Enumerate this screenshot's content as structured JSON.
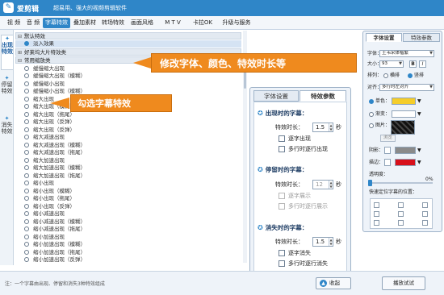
{
  "app": {
    "name": "爱剪辑",
    "tagline": "超易用、强大的视频剪辑软件"
  },
  "menu": [
    "视 频",
    "音 频",
    "字幕特效",
    "叠加素材",
    "转场特效",
    "画面风格",
    "M T V",
    "卡拉OK",
    "升级与服务"
  ],
  "active_menu_index": 2,
  "left_tabs": [
    {
      "label": "出现特效",
      "active": true
    },
    {
      "label": "停留特效",
      "active": false
    },
    {
      "label": "消失特效",
      "active": false
    }
  ],
  "tree": {
    "groups": [
      {
        "label": "默认特效",
        "items": [
          {
            "label": "淡入效果",
            "selected": true
          }
        ]
      },
      {
        "label": "好莱坞大片特效类",
        "items": []
      },
      {
        "label": "常用缩放类",
        "items": [
          {
            "label": "缓慢缩大出现"
          },
          {
            "label": "缓慢缩大出现（模糊）"
          },
          {
            "label": "缓慢缩小出现"
          },
          {
            "label": "缓慢缩小出现（模糊）"
          },
          {
            "label": "缩大出现"
          },
          {
            "label": "缩大出现（模糊）"
          },
          {
            "label": "缩大出现（拖尾）"
          },
          {
            "label": "缩大出现（反弹）"
          },
          {
            "label": "缩大出现（反弹）"
          },
          {
            "label": "缩大减速出现"
          },
          {
            "label": "缩大减速出现（模糊）"
          },
          {
            "label": "缩大减速出现（拖尾）"
          },
          {
            "label": "缩大加速出现"
          },
          {
            "label": "缩大加速出现（模糊）"
          },
          {
            "label": "缩大加速出现（拖尾）"
          },
          {
            "label": "缩小出现"
          },
          {
            "label": "缩小出现（模糊）"
          },
          {
            "label": "缩小出现（拖尾）"
          },
          {
            "label": "缩小出现（反弹）"
          },
          {
            "label": "缩小减速出现"
          },
          {
            "label": "缩小减速出现（模糊）"
          },
          {
            "label": "缩小减速出现（拖尾）"
          },
          {
            "label": "缩小加速出现"
          },
          {
            "label": "缩小加速出现（模糊）"
          },
          {
            "label": "缩小加速出现（拖尾）"
          },
          {
            "label": "缩小加速出现（反弹）"
          }
        ]
      }
    ]
  },
  "callouts": {
    "select_effect": "勾选字幕特效",
    "modify_font": "修改字体、颜色、特效时长等"
  },
  "effect_panel": {
    "tabs": [
      "字体设置",
      "特效参数"
    ],
    "active_tab": 1,
    "duration_label": "特效时长：",
    "unit": "秒",
    "sections": [
      {
        "title": "出现时的字幕：",
        "duration": "1.5",
        "disabled": false,
        "options": [
          {
            "label": "逐字出现",
            "disabled": false
          },
          {
            "label": "多行时逐行出现",
            "disabled": false
          }
        ]
      },
      {
        "title": "停留时的字幕：",
        "duration": "12",
        "disabled": true,
        "options": [
          {
            "label": "逐字展示",
            "disabled": true
          },
          {
            "label": "多行时逐行展示",
            "disabled": true
          }
        ]
      },
      {
        "title": "消失时的字幕：",
        "duration": "1.5",
        "disabled": false,
        "options": [
          {
            "label": "逐字消失",
            "disabled": false
          },
          {
            "label": "多行时逐行消失",
            "disabled": false
          }
        ]
      }
    ]
  },
  "font_panel": {
    "tabs": [
      "字体设置",
      "特效参数"
    ],
    "active_tab": 0,
    "font_label": "字体：",
    "font_value": "王韦宋体楷繁",
    "size_label": "大小：",
    "size_value": "93",
    "bold": "B",
    "italic": "I",
    "layout_label": "排列：",
    "layout_options": [
      "横排",
      "竖排"
    ],
    "layout_selected": 1,
    "align_label": "对齐：",
    "align_value": "多行时左对齐",
    "fill_options": [
      "单色：",
      "渐变：",
      "图片："
    ],
    "fill_selected": 0,
    "single_color": "#f5cd2a",
    "gradient_color": "#ffffff",
    "browse_label": "浏览",
    "shadow_label": "阴影：",
    "shadow_color": "#8a8a8a",
    "stroke_label": "描边：",
    "stroke_color": "#d8101a",
    "opacity_label": "透明度：",
    "opacity_value": "0%",
    "opacity_level": 0,
    "position_label": "快速定位字幕的位置："
  },
  "status": {
    "note": "注：一个字幕由出现、停留和消失3种特效组成",
    "collapse_label": "收起",
    "preview_label": "播放试试"
  },
  "colors": {
    "accent": "#2f86c8",
    "callout": "#ef8a1e"
  }
}
